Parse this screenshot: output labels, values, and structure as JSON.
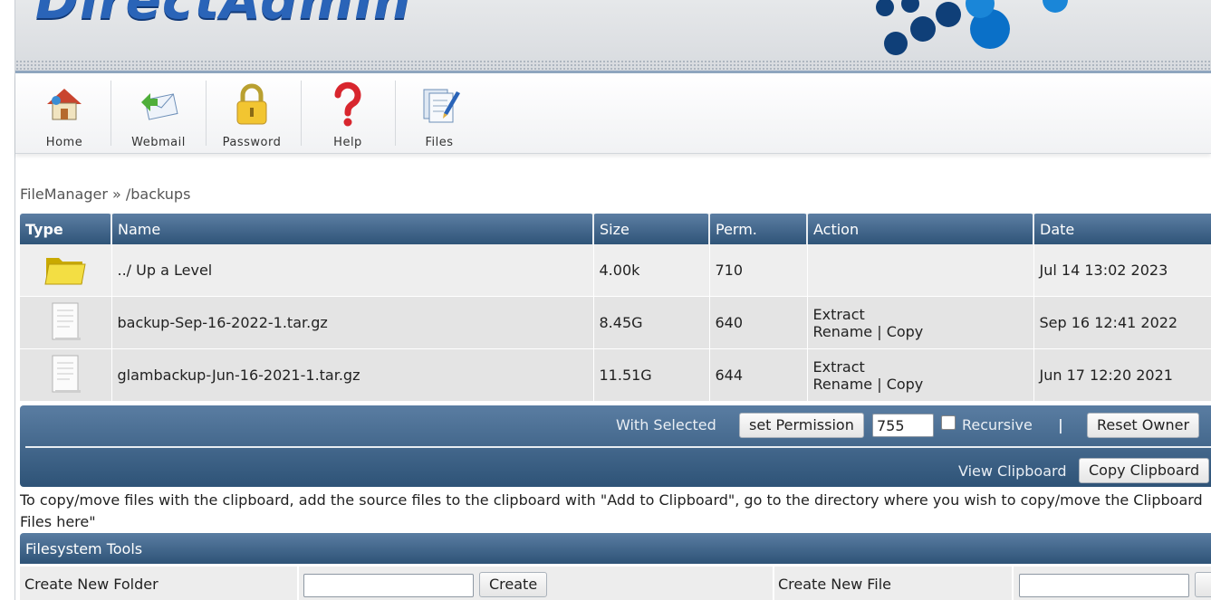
{
  "header": {
    "logo_text": "DirectAdmin"
  },
  "toolbar": {
    "items": [
      {
        "label": "Home",
        "icon": "house-icon"
      },
      {
        "label": "Webmail",
        "icon": "webmail-icon"
      },
      {
        "label": "Password",
        "icon": "padlock-icon"
      },
      {
        "label": "Help",
        "icon": "question-mark-icon"
      },
      {
        "label": "Files",
        "icon": "files-icon"
      }
    ]
  },
  "breadcrumb": "FileManager » /backups",
  "table": {
    "headers": {
      "type": "Type",
      "name": "Name",
      "size": "Size",
      "perm": "Perm.",
      "action": "Action",
      "date": "Date"
    },
    "rows": [
      {
        "icon": "folder-icon",
        "name": "../ Up a Level",
        "size": "4.00k",
        "perm": "710",
        "action_extract": "",
        "action_rename": "",
        "action_copy": "",
        "date": "Jul 14 13:02 2023"
      },
      {
        "icon": "file-icon",
        "name": "backup-Sep-16-2022-1.tar.gz",
        "size": "8.45G",
        "perm": "640",
        "action_extract": "Extract",
        "action_rename": "Rename",
        "action_copy": "Copy",
        "date": "Sep 16 12:41 2022"
      },
      {
        "icon": "file-icon",
        "name": "glambackup-Jun-16-2021-1.tar.gz",
        "size": "11.51G",
        "perm": "644",
        "action_extract": "Extract",
        "action_rename": "Rename",
        "action_copy": "Copy",
        "date": "Jun 17 12:20 2021"
      }
    ]
  },
  "selection_bar": {
    "with_selected": "With Selected",
    "set_permission": "set Permission",
    "permission_value": "755",
    "recursive": "Recursive",
    "separator": "|",
    "reset_owner": "Reset Owner",
    "view_clipboard": "View Clipboard",
    "copy_clipboard": "Copy Clipboard"
  },
  "clipboard_note": "To copy/move files with the clipboard, add the source files to the clipboard with \"Add to Clipboard\", go to the directory where you wish to copy/move the Clipboard Files here\"",
  "fs_tools": {
    "title": "Filesystem Tools",
    "create_folder_label": "Create New Folder",
    "create_button": "Create",
    "create_file_label": "Create New File"
  },
  "colors": {
    "header_blue": "#2f5478",
    "logo_blue": "#2a64b8"
  }
}
